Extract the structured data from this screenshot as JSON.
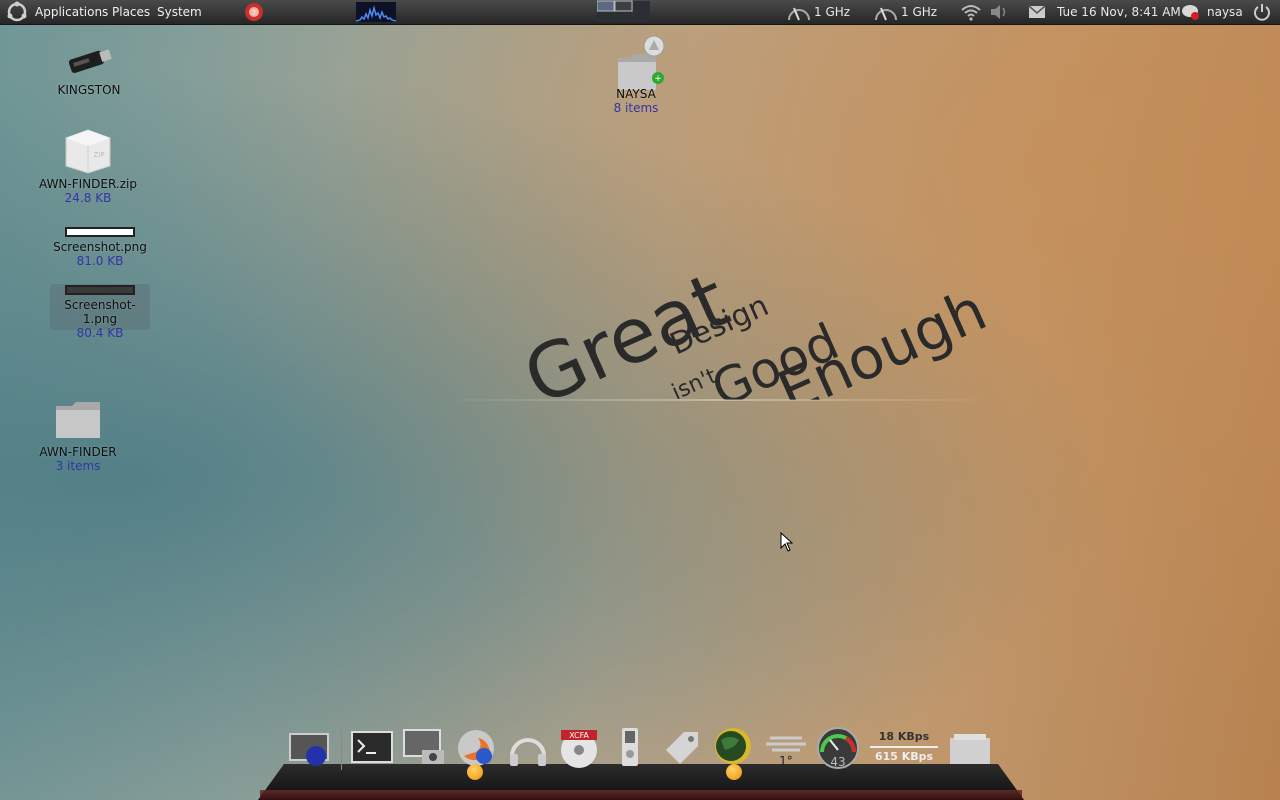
{
  "top_panel": {
    "menus": [
      "Applications",
      "Places",
      "System"
    ],
    "cpu1": "1 GHz",
    "cpu2": "1 GHz",
    "datetime": "Tue 16 Nov,  8:41 AM",
    "username": "naysa",
    "icons": [
      "ubuntu-logo-icon",
      "pidgin-icon",
      "system-monitor-icon",
      "workspace-switcher-icon",
      "cpu-freq-icon",
      "wifi-icon",
      "volume-icon",
      "mail-icon",
      "user-status-icon",
      "power-icon"
    ]
  },
  "desktop": {
    "icons": [
      {
        "label": "KINGSTON",
        "sub": ""
      },
      {
        "label": "AWN-FINDER.zip",
        "sub": "24.8 KB"
      },
      {
        "label": "Screenshot.png",
        "sub": "81.0 KB"
      },
      {
        "label": "Screenshot-1.png",
        "sub": "80.4 KB"
      },
      {
        "label": "AWN-FINDER",
        "sub": "3 items"
      },
      {
        "label": "NAYSA",
        "sub": "8 items"
      }
    ]
  },
  "wallpaper": {
    "words": [
      "Great",
      "Design",
      "isn't",
      "Good",
      "Enough"
    ]
  },
  "dock": {
    "items": [
      "show-desktop",
      "terminal",
      "screenshot",
      "firefox",
      "music",
      "xcfa",
      "ipod",
      "tag",
      "sun-globe",
      "weather",
      "cpu-gauge",
      "network-monitor",
      "file-manager"
    ],
    "weather_temp": "1°",
    "cpu_value": "43",
    "net_up": "18 KBps",
    "net_down": "615 KBps",
    "xcfa_label": "XCFA"
  },
  "colors": {
    "panel": "#2f2f2f",
    "accent_link": "#3533a8",
    "indicator_orange": "#f29000"
  }
}
